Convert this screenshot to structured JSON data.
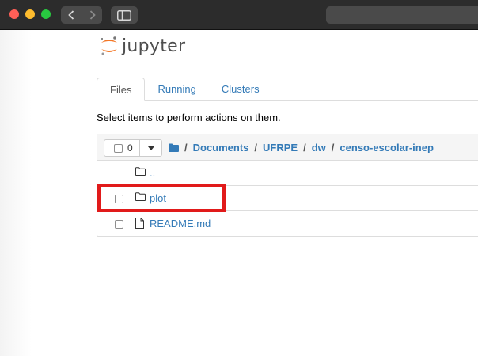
{
  "window": {
    "colors": {
      "close": "#fe5f57",
      "minimize": "#febc2e",
      "zoom": "#28c840"
    },
    "icons": [
      "back-chevron-icon",
      "forward-chevron-icon",
      "sidebar-icon"
    ]
  },
  "header": {
    "logo_text": "jupyter",
    "logo_icon": "jupyter-orbit-icon"
  },
  "tabs": [
    {
      "label": "Files",
      "active": true
    },
    {
      "label": "Running",
      "active": false
    },
    {
      "label": "Clusters",
      "active": false
    }
  ],
  "hint": "Select items to perform actions on them.",
  "toolbar": {
    "selected_count": "0"
  },
  "breadcrumb": {
    "separator": "/",
    "items": [
      "Documents",
      "UFRPE",
      "dw",
      "censo-escolar-inep"
    ]
  },
  "files": [
    {
      "name": "..",
      "type": "folder",
      "checkbox": false
    },
    {
      "name": "plot",
      "type": "folder",
      "checkbox": true
    },
    {
      "name": "README.md",
      "type": "file",
      "checkbox": true
    }
  ],
  "accent_colors": {
    "link": "#337ab7",
    "highlight": "#e11a1a",
    "logo_orange": "#f37726"
  }
}
